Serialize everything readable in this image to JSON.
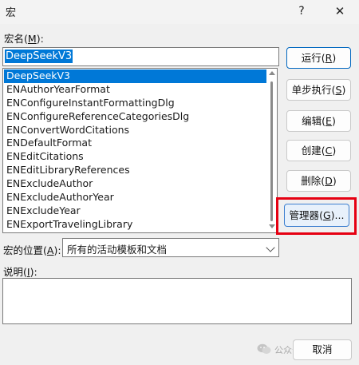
{
  "window": {
    "title": "宏",
    "help_label": "?",
    "close_label": "✕"
  },
  "macro_name": {
    "label_text": "宏名",
    "label_key": "M",
    "value": "DeepSeekV3"
  },
  "macro_list": {
    "items": [
      "DeepSeekV3",
      "ENAuthorYearFormat",
      "ENConfigureInstantFormattingDlg",
      "ENConfigureReferenceCategoriesDlg",
      "ENConvertWordCitations",
      "ENDefaultFormat",
      "ENEditCitations",
      "ENEditLibraryReferences",
      "ENExcludeAuthor",
      "ENExcludeAuthorYear",
      "ENExcludeYear",
      "ENExportTravelingLibrary"
    ],
    "selected": "DeepSeekV3"
  },
  "buttons": {
    "run": {
      "text": "运行",
      "key": "R"
    },
    "step": {
      "text": "单步执行",
      "key": "S"
    },
    "edit": {
      "text": "编辑",
      "key": "E"
    },
    "create": {
      "text": "创建",
      "key": "C"
    },
    "delete": {
      "text": "删除",
      "key": "D"
    },
    "organizer": {
      "text": "管理器",
      "key": "G",
      "suffix": "..."
    },
    "cancel": {
      "text": "取消"
    }
  },
  "location": {
    "label_text": "宏的位置",
    "label_key": "A",
    "selected": "所有的活动模板和文档"
  },
  "description": {
    "label_text": "说明",
    "label_key": "I",
    "value": ""
  },
  "watermark": {
    "text": "公众号 · 技"
  },
  "colors": {
    "selection": "#0078d7",
    "highlight_box": "#e60012",
    "primary_border": "#0067c0"
  }
}
